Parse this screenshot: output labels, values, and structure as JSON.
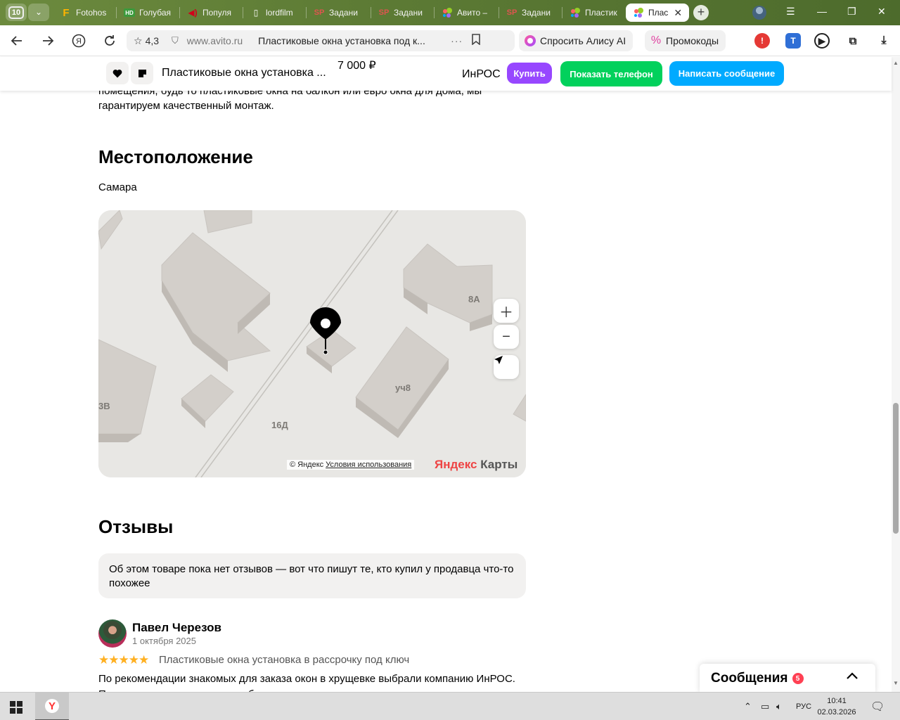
{
  "browser": {
    "tab_count": "10",
    "tabs": [
      {
        "label": "Fotohos",
        "icon": "fotohost-favicon-icon"
      },
      {
        "label": "Голубая",
        "icon": "hd-favicon-icon"
      },
      {
        "label": "Популя",
        "icon": "speaker-favicon-icon"
      },
      {
        "label": "lordfilm",
        "icon": "document-favicon-icon"
      },
      {
        "label": "Задани",
        "icon": "sp-favicon-icon"
      },
      {
        "label": "Задани",
        "icon": "sp-favicon-icon"
      },
      {
        "label": "Авито –",
        "icon": "avito-favicon-icon"
      },
      {
        "label": "Задани",
        "icon": "sp-favicon-icon"
      },
      {
        "label": "Пластик",
        "icon": "avito-favicon-icon"
      },
      {
        "label": "Плас",
        "icon": "avito-favicon-icon",
        "active": true
      }
    ],
    "address": {
      "rating": "4,3",
      "domain": "www.avito.ru",
      "page_title": "Пластиковые окна установка под к..."
    },
    "alice_label": "Спросить Алису AI",
    "promocodes_label": "Промокоды"
  },
  "sticky_header": {
    "title": "Пластиковые окна установка ...",
    "price": "7 000 ₽",
    "seller": "ИнРОС",
    "buy_label": "Купить",
    "show_phone_label": "Показать телефон",
    "write_message_label": "Написать сообщение"
  },
  "description_tail": {
    "line1": "помещения, будь то пластиковые окна на балкон или евро окна для дома, мы",
    "line2": "гарантируем качественный монтаж."
  },
  "location": {
    "heading": "Местоположение",
    "city": "Самара",
    "map": {
      "labels": [
        "8А",
        "уч8",
        "3В",
        "16Д"
      ],
      "attribution": "© Яндекс",
      "terms_link": "Условия использования",
      "logo_part1": "Яндекс",
      "logo_part2": " Карты"
    }
  },
  "reviews": {
    "heading": "Отзывы",
    "empty_notice": "Об этом товаре пока нет отзывов — вот что пишут те, кто купил у продавца что-то похожее",
    "items": [
      {
        "author": "Павел Черезов",
        "date": "1 октября 2025",
        "rating": 5,
        "stars": "★★★★★",
        "item": "Пластиковые окна установка в рассрочку под ключ",
        "text": "По рекомендации знакомых для заказа окон в хрущевке выбрали компанию ИнРОС. Позвонили, и менеджер подробно ответил на все вопросы, сразу сориентировав"
      }
    ]
  },
  "messages": {
    "label": "Сообщения",
    "count": "5"
  },
  "taskbar": {
    "language": "РУС",
    "time": "10:41",
    "date": "02.03.2026"
  },
  "colors": {
    "buy": "#9747ff",
    "show_phone": "#02d15c",
    "write_message": "#00aaff",
    "badge": "#ff4053",
    "stars": "#ffb021"
  }
}
